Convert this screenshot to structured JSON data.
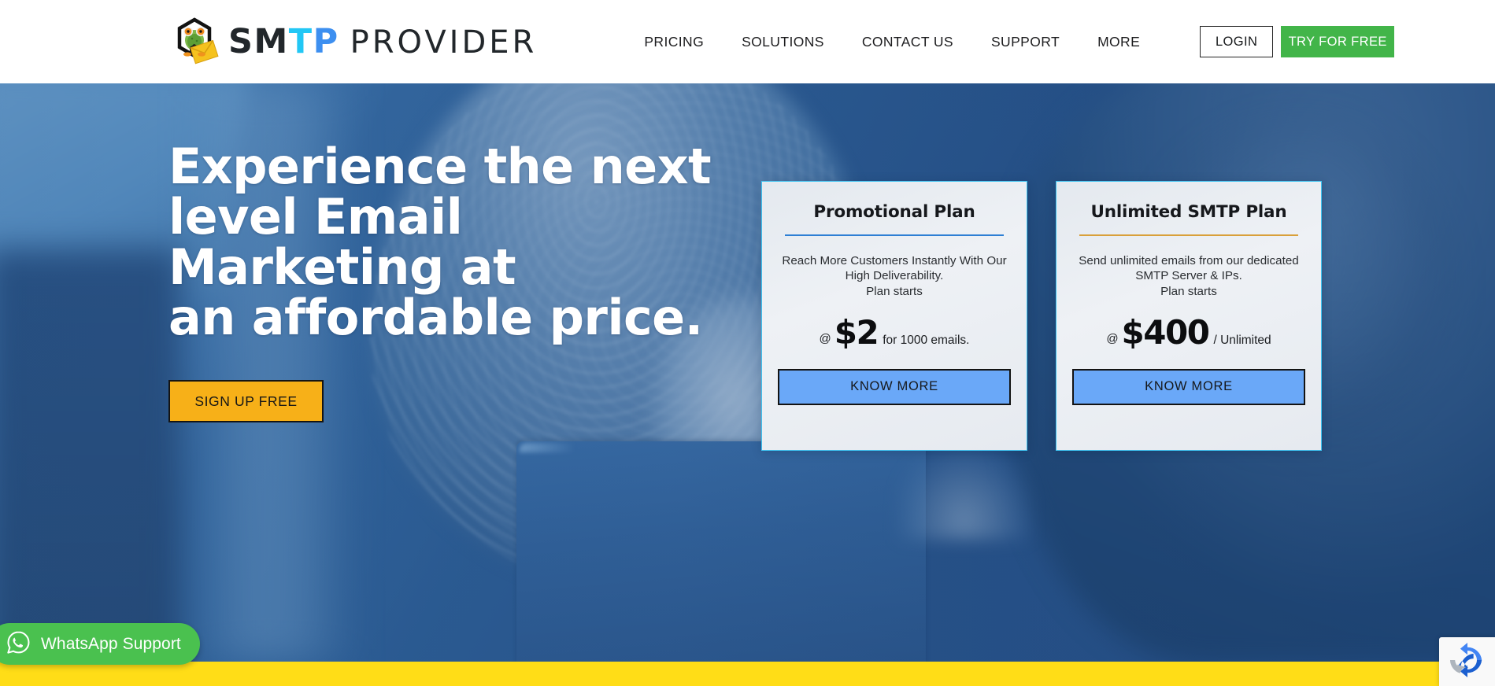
{
  "header": {
    "logo": {
      "icon": "frog-envelope-logo",
      "wordmark_sm": "SM",
      "wordmark_t": "T",
      "wordmark_p": "P",
      "wordmark_provider": "PROVIDER"
    },
    "nav": [
      {
        "label": "PRICING"
      },
      {
        "label": "SOLUTIONS"
      },
      {
        "label": "CONTACT US"
      },
      {
        "label": "SUPPORT"
      },
      {
        "label": "MORE"
      }
    ],
    "login_label": "LOGIN",
    "try_label": "TRY FOR FREE",
    "try_color": "#42b549"
  },
  "hero": {
    "title_lines": [
      "Experience the next",
      "level Email",
      "Marketing at",
      "an affordable price."
    ],
    "cta_label": "SIGN UP FREE",
    "cta_color": "#f7b018"
  },
  "plans": [
    {
      "title": "Promotional Plan",
      "rule_color": "#2e7fd4",
      "desc_lines": [
        "Reach More Customers Instantly With Our",
        "High Deliverability.",
        "Plan starts"
      ],
      "price_at": "@",
      "price_amount": "$2",
      "price_suffix": "for 1000 emails.",
      "button_label": "KNOW MORE",
      "button_color": "#6aa8f8"
    },
    {
      "title": "Unlimited SMTP Plan",
      "rule_color": "#d9a03a",
      "desc_lines": [
        "Send unlimited emails from our dedicated",
        "SMTP Server & IPs.",
        "Plan starts"
      ],
      "price_at": "@",
      "price_amount": "$400",
      "price_suffix": "/ Unlimited",
      "button_label": "KNOW MORE",
      "button_color": "#6aa8f8"
    }
  ],
  "whatsapp": {
    "icon": "whatsapp-icon",
    "label": "WhatsApp Support",
    "color": "#4ac14f"
  },
  "recaptcha": {
    "icon": "recaptcha-icon"
  },
  "bottom_bar": {
    "color": "#ffdd17"
  }
}
